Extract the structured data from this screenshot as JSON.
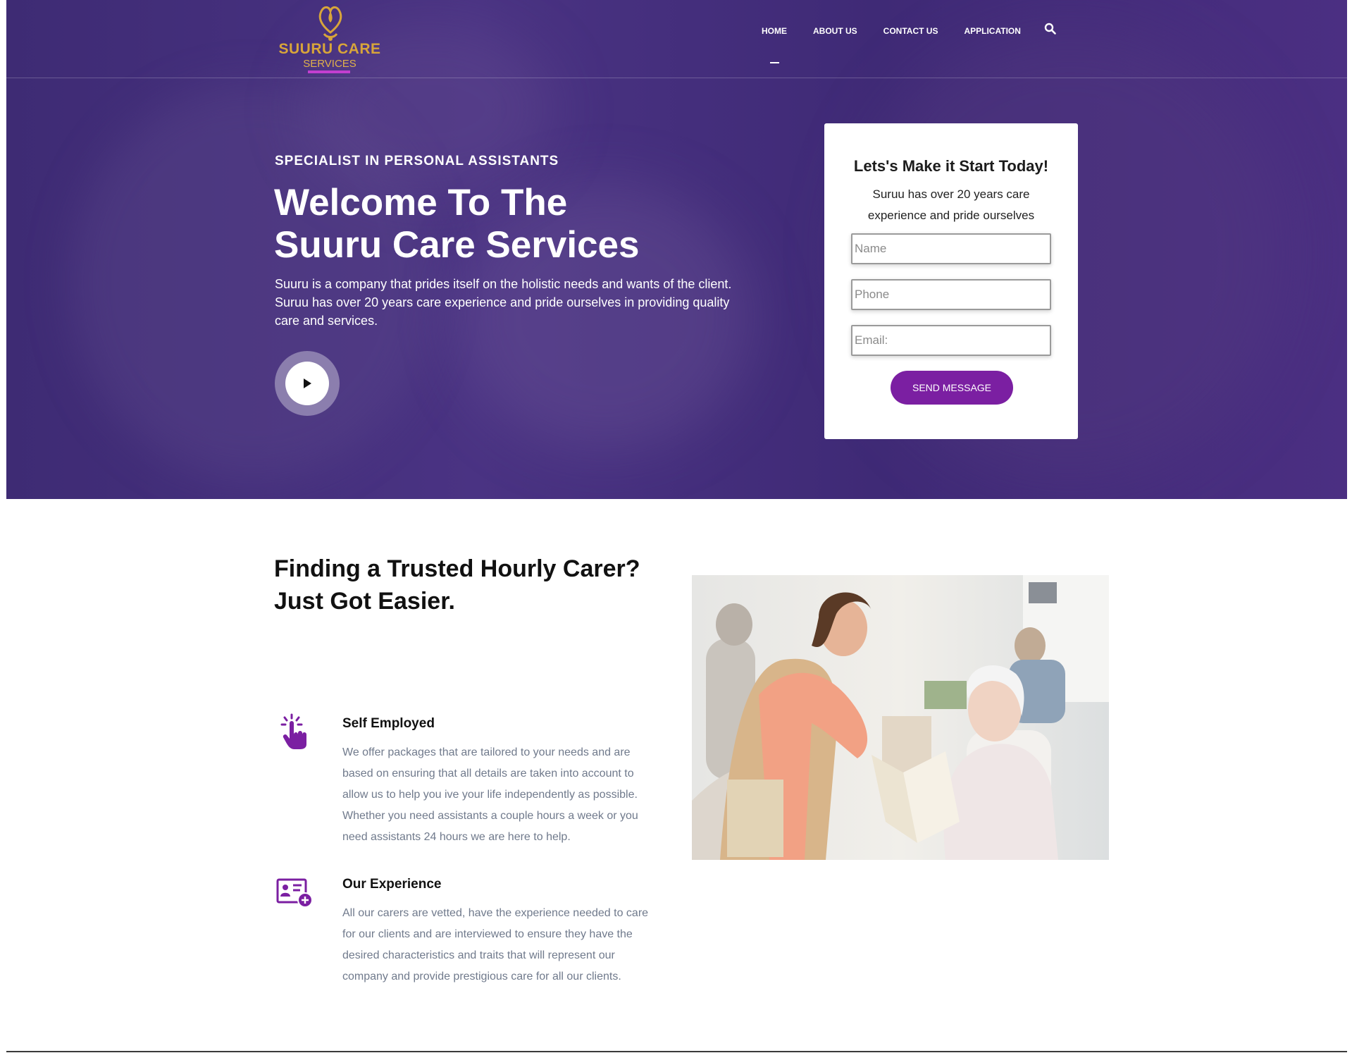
{
  "brand": {
    "name": "SUURU CARE",
    "sub": "SERVICES",
    "colors": {
      "gold": "#d8a53a",
      "hero_bg": "#452f7d",
      "accent": "#7b1fa2"
    }
  },
  "nav": {
    "items": [
      {
        "label": "HOME",
        "active": true
      },
      {
        "label": "ABOUT US"
      },
      {
        "label": "CONTACT US"
      },
      {
        "label": "APPLICATION"
      }
    ],
    "search_icon": "search-icon"
  },
  "hero": {
    "kicker": "SPECIALIST IN PERSONAL ASSISTANTS",
    "title_line1": "Welcome To The",
    "title_line2": "Suuru Care Services",
    "description": "Suuru is a company that prides itself on the holistic needs and wants of the client. Suruu has over 20 years care experience and pride ourselves in providing quality care and services.",
    "play_icon": "play-icon"
  },
  "form": {
    "title": "Lets's Make it Start Today!",
    "description": "Suruu has over 20 years care experience and pride ourselves",
    "name_placeholder": "Name",
    "phone_placeholder": "Phone",
    "email_placeholder": "Email:",
    "submit_label": "SEND MESSAGE"
  },
  "section": {
    "title_line1": "Finding a Trusted Hourly Carer?",
    "title_line2": "Just Got Easier.",
    "features": [
      {
        "icon": "tap-hand-icon",
        "title": "Self Employed",
        "description": "We offer packages that are tailored to your needs and are based on ensuring that all details are taken into account to allow us to help you ive your life independently as possible. Whether you need assistants a couple hours a week or you need assistants 24 hours we are here to help."
      },
      {
        "icon": "id-card-add-icon",
        "title": "Our Experience",
        "description": "All our carers are vetted, have the experience needed to care for our clients and are interviewed to ensure they have the desired characteristics and traits that will represent our company and provide prestigious care for all our clients."
      }
    ]
  }
}
